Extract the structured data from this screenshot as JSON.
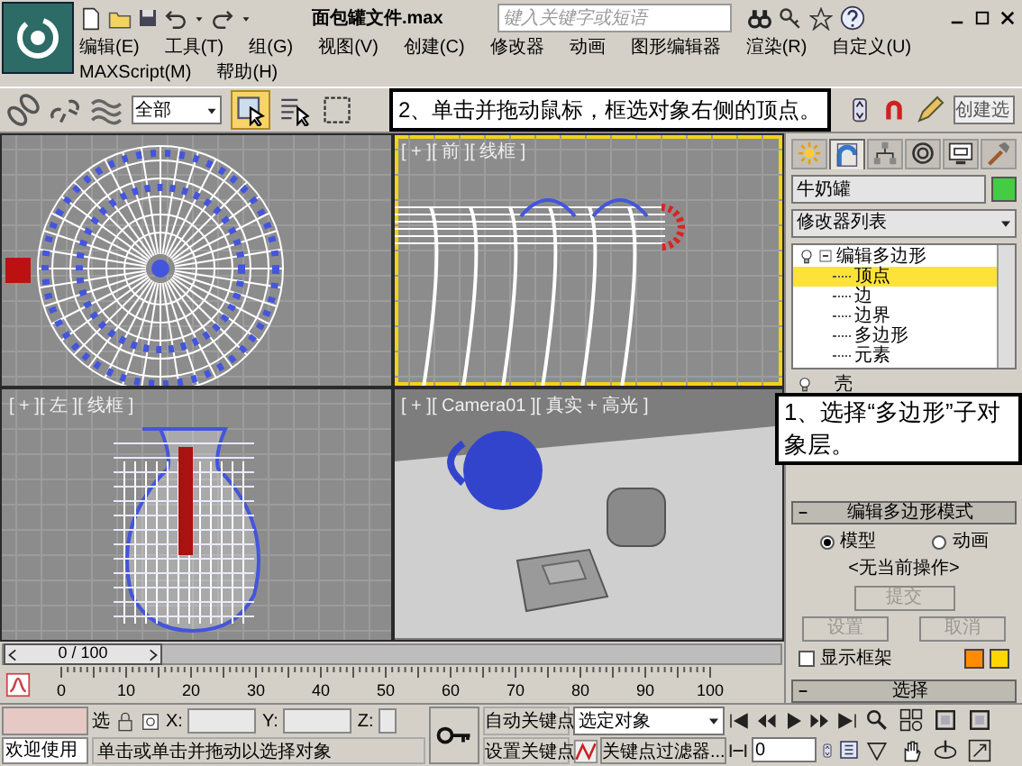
{
  "title_bar": {
    "title": "面包罐文件.max",
    "search_placeholder": "键入关键字或短语"
  },
  "menu": [
    {
      "label": "编辑(E)"
    },
    {
      "label": "工具(T)"
    },
    {
      "label": "组(G)"
    },
    {
      "label": "视图(V)"
    },
    {
      "label": "创建(C)"
    },
    {
      "label": "修改器"
    },
    {
      "label": "动画"
    },
    {
      "label": "图形编辑器"
    },
    {
      "label": "渲染(R)"
    },
    {
      "label": "自定义(U)"
    },
    {
      "label": "MAXScript(M)"
    },
    {
      "label": "帮助(H)"
    }
  ],
  "toolbar": {
    "selection_filter": "全部",
    "select_active": true,
    "overflow_button": "创建选",
    "callout": "2、单击并拖动鼠标，框选对象右侧的顶点。"
  },
  "viewports": [
    {
      "kind": "top",
      "active": false
    },
    {
      "kind": "front",
      "label": "[ + ][ 前 ][ 线框 ]",
      "active": true
    },
    {
      "kind": "left",
      "label": "[ + ][ 左 ][ 线框 ]",
      "active": false
    },
    {
      "kind": "camera",
      "label": "[ + ][ Camera01 ][ 真实 + 高光 ]",
      "active": false
    }
  ],
  "command_panel": {
    "tabs": [
      {
        "kind": "create",
        "selected": false
      },
      {
        "kind": "modify",
        "selected": true
      },
      {
        "kind": "hierarchy",
        "selected": false
      },
      {
        "kind": "motion",
        "selected": false
      },
      {
        "kind": "display",
        "selected": false
      },
      {
        "kind": "utilities",
        "selected": false
      }
    ],
    "object_name": "牛奶罐",
    "modifier_list": "修改器列表",
    "modifier_stack": [
      {
        "label": "编辑多边形",
        "expanded": true,
        "selected": false,
        "children": [
          {
            "label": "顶点",
            "selected": true
          },
          {
            "label": "边",
            "selected": false
          },
          {
            "label": "边界",
            "selected": false
          },
          {
            "label": "多边形",
            "selected": false
          },
          {
            "label": "元素",
            "selected": false
          }
        ]
      },
      {
        "label": "壳",
        "selected": false
      }
    ],
    "callout": "1、选择“多边形”子对象层。",
    "edit_poly_mode": {
      "title": "编辑多边形模式",
      "modes": [
        {
          "label": "模型",
          "selected": true
        },
        {
          "label": "动画",
          "selected": false
        }
      ],
      "current_operation": "<无当前操作>",
      "commit": {
        "label": "提交",
        "disabled": true
      },
      "buttons": [
        {
          "label": "设置",
          "disabled": true
        },
        {
          "label": "取消",
          "disabled": true
        }
      ],
      "show_cage": {
        "label": "显示框架",
        "checked": false
      },
      "cage_colors": [
        {
          "color": "#ff8c00"
        },
        {
          "color": "#ffd700"
        }
      ]
    },
    "selection_rollout": "选择"
  },
  "time_slider": {
    "text": "0 / 100",
    "level": 0
  },
  "ruler": [
    "0",
    "10",
    "20",
    "30",
    "40",
    "50",
    "60",
    "70",
    "80",
    "90",
    "100"
  ],
  "status_bar": {
    "welcome": "欢迎使用",
    "selection_label": "选",
    "x_label": "X:",
    "y_label": "Y:",
    "z_label": "Z:",
    "prompt": "单击或单击并拖动以选择对象",
    "auto_key": "自动关键点",
    "set_key": "设置关键点",
    "key_mode": "选定对象",
    "key_filters": "关键点过滤器...",
    "frame": "0"
  }
}
